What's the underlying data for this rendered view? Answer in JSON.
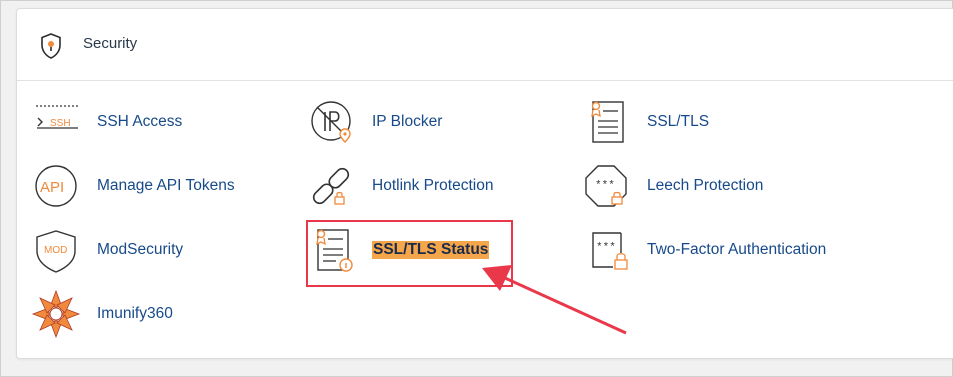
{
  "section": {
    "title": "Security",
    "icon": "shield-icon"
  },
  "tools": [
    {
      "label": "SSH Access",
      "icon": "ssh-terminal-icon"
    },
    {
      "label": "IP Blocker",
      "icon": "ip-blocker-icon"
    },
    {
      "label": "SSL/TLS",
      "icon": "certificate-document-icon"
    },
    {
      "label": "Manage API Tokens",
      "icon": "api-icon"
    },
    {
      "label": "Hotlink Protection",
      "icon": "chain-link-icon"
    },
    {
      "label": "Leech Protection",
      "icon": "password-octagon-icon"
    },
    {
      "label": "ModSecurity",
      "icon": "mod-shield-icon"
    },
    {
      "label": "SSL/TLS Status",
      "icon": "certificate-status-icon"
    },
    {
      "label": "Two-Factor Authentication",
      "icon": "two-factor-lock-icon"
    },
    {
      "label": "Imunify360",
      "icon": "imunify360-logo-icon"
    }
  ],
  "colors": {
    "link": "#174a8a",
    "accent_orange": "#f08a3c",
    "highlight": "#f5a54a",
    "annotation_red": "#e8384a"
  }
}
